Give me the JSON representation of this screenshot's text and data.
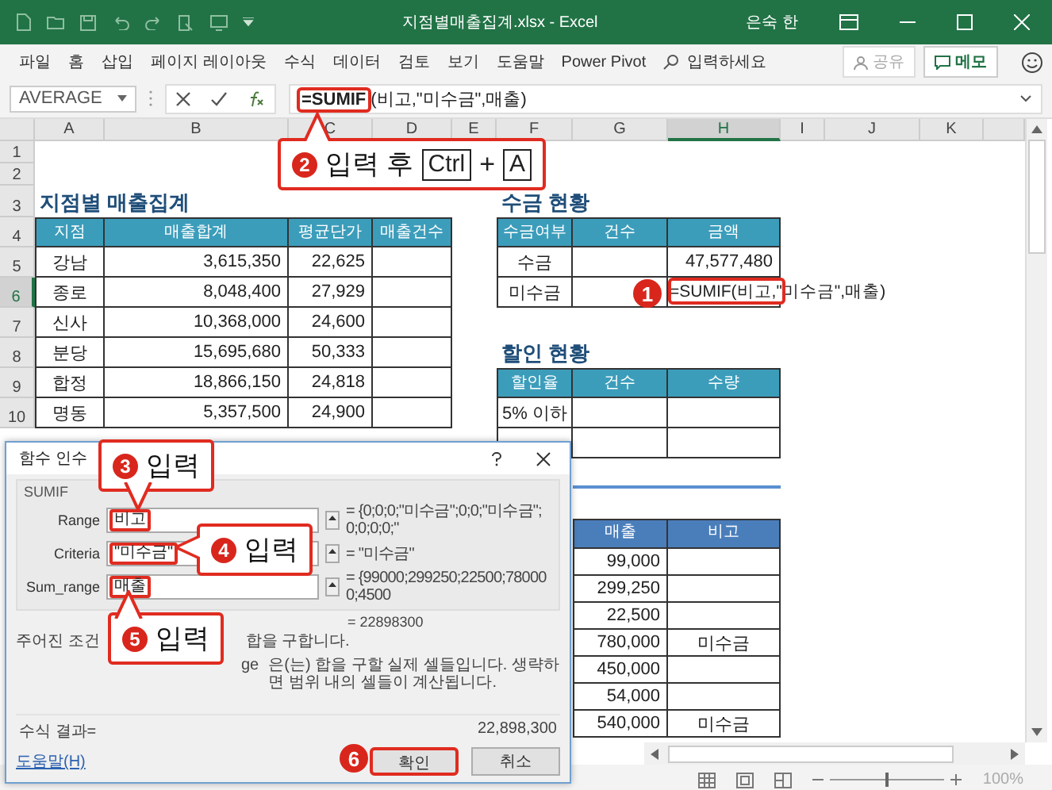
{
  "window": {
    "title": "지점별매출집계.xlsx - Excel",
    "user": "은숙 한"
  },
  "ribbon": {
    "tabs": [
      "파일",
      "홈",
      "삽입",
      "페이지 레이아웃",
      "수식",
      "데이터",
      "검토",
      "보기",
      "도움말",
      "Power Pivot"
    ],
    "search_placeholder": "입력하세요",
    "share": "공유",
    "comments": "메모"
  },
  "formula_bar": {
    "name_box": "AVERAGE",
    "formula": "**=SUMIF**(비고,\"미수금\",매출)"
  },
  "sheet": {
    "columns": [
      {
        "label": "A",
        "selected": false
      },
      {
        "label": "B",
        "selected": false
      },
      {
        "label": "C",
        "selected": false
      },
      {
        "label": "D",
        "selected": false
      },
      {
        "label": "E",
        "selected": false
      },
      {
        "label": "F",
        "selected": false
      },
      {
        "label": "G",
        "selected": false
      },
      {
        "label": "H",
        "selected": true
      },
      {
        "label": "I",
        "selected": false
      },
      {
        "label": "J",
        "selected": false
      },
      {
        "label": "K",
        "selected": false
      }
    ],
    "rows": [
      {
        "label": "1",
        "selected": false
      },
      {
        "label": "2",
        "selected": false
      },
      {
        "label": "3",
        "selected": false
      },
      {
        "label": "4",
        "selected": false
      },
      {
        "label": "5",
        "selected": false
      },
      {
        "label": "6",
        "selected": true
      },
      {
        "label": "7",
        "selected": false
      },
      {
        "label": "8",
        "selected": false
      },
      {
        "label": "9",
        "selected": false
      },
      {
        "label": "10",
        "selected": false
      }
    ],
    "tables": [
      {
        "title": "지점별 매출집계",
        "headers": [
          "지점",
          "매출합계",
          "평균단가",
          "매출건수"
        ],
        "rows": [
          [
            "강남",
            "3,615,350",
            "22,625",
            null
          ],
          [
            "종로",
            "8,048,400",
            "27,929",
            null
          ],
          [
            "신사",
            "10,368,000",
            "24,600",
            null
          ],
          [
            "분당",
            "15,695,680",
            "50,333",
            null
          ],
          [
            "합정",
            "18,866,150",
            "24,818",
            null
          ],
          [
            "명동",
            "5,357,500",
            "24,900",
            null
          ]
        ]
      },
      {
        "title": "수금 현황",
        "headers": [
          "수금여부",
          "건수",
          "금액"
        ],
        "rows": [
          [
            "수금",
            null,
            "47,577,480"
          ],
          [
            "미수금",
            null,
            {
              "formula": "=SUMIF(비고,\"미수금\",매출)"
            }
          ]
        ]
      },
      {
        "title": "할인 현황",
        "headers": [
          "할인율",
          "건수",
          "수량"
        ],
        "rows": [
          [
            "5% 이하",
            null,
            null
          ],
          [
            null,
            null,
            null
          ]
        ]
      },
      {
        "headers": [
          "매출",
          "비고"
        ],
        "rows": [
          [
            "99,000",
            null
          ],
          [
            "299,250",
            null
          ],
          [
            "22,500",
            null
          ],
          [
            "780,000",
            "미수금"
          ],
          [
            "450,000",
            null
          ],
          [
            "54,000",
            null
          ],
          [
            "540,000",
            "미수금"
          ]
        ]
      }
    ]
  },
  "dialog": {
    "title": "함수 인수",
    "function_name": "SUMIF",
    "arguments": [
      {
        "label": "Range",
        "value": "비고",
        "result": "= {0;0;0;\"미수금\";0;0;\"미수금\";0;0;0;0;\""
      },
      {
        "label": "Criteria",
        "value": "\"미수금\"",
        "result": "= \"미수금\""
      },
      {
        "label": "Sum_range",
        "value": "매출",
        "result": "= {99000;299250;22500;780000;4500"
      }
    ],
    "result": "= 22898300",
    "description_parts": [
      "주어진 조건",
      "합을 구합니다."
    ],
    "argument_help_parts": [
      "ge",
      "은(는) 합을 구할 실제 셀들입니다. 생략하면 범위 내의 셀들이 계산됩니다."
    ],
    "formula_result_label": "수식 결과=",
    "formula_result": "22,898,300",
    "help_link": "도움말(H)",
    "buttons": [
      "확인",
      "취소"
    ]
  },
  "callouts": [
    {
      "step": "1"
    },
    {
      "step": "2",
      "text": "입력 후",
      "keys": [
        "Ctrl",
        "A"
      ],
      "joiner": "+"
    },
    {
      "step": "3",
      "text": "입력"
    },
    {
      "step": "4",
      "text": "입력"
    },
    {
      "step": "5",
      "text": "입력"
    },
    {
      "step": "6"
    }
  ],
  "status_bar": {
    "zoom": "100%",
    "zoom_slider": {
      "level": 0.5
    }
  }
}
